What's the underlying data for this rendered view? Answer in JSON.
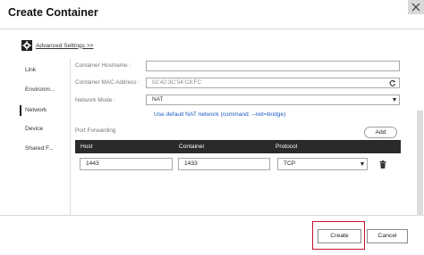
{
  "dialog": {
    "title": "Create Container"
  },
  "advanced": {
    "label": "Advanced Settings >>"
  },
  "sidebar": {
    "items": [
      {
        "label": "Link",
        "active": false
      },
      {
        "label": "Environm...",
        "active": false
      },
      {
        "label": "Network",
        "active": true
      },
      {
        "label": "Device",
        "active": false
      },
      {
        "label": "Shared F...",
        "active": false
      }
    ]
  },
  "network": {
    "hostname_label": "Container Hostname :",
    "hostname_value": "",
    "mac_label": "Container MAC Address :",
    "mac_value": "02:42:3C:54:C8:FC",
    "mode_label": "Network Mode :",
    "mode_value": "NAT",
    "hint": "Use default NAT network (command: --net=bridge)"
  },
  "port_forwarding": {
    "label": "Port Forwarding",
    "add_label": "Add",
    "columns": [
      "Host",
      "Container",
      "Protocol"
    ],
    "rows": [
      {
        "host": "1443",
        "container": "1433",
        "protocol": "TCP"
      }
    ]
  },
  "footer": {
    "create_label": "Create",
    "cancel_label": "Cancel"
  },
  "colors": {
    "accent_link": "#1a5bbf",
    "header_bg": "#2a2a2a",
    "highlight": "#c8102e"
  },
  "icons": {
    "gear": "gear-icon",
    "close": "close-icon",
    "refresh": "refresh-icon",
    "trash": "trash-icon",
    "dropdown": "chevron-down-icon"
  }
}
